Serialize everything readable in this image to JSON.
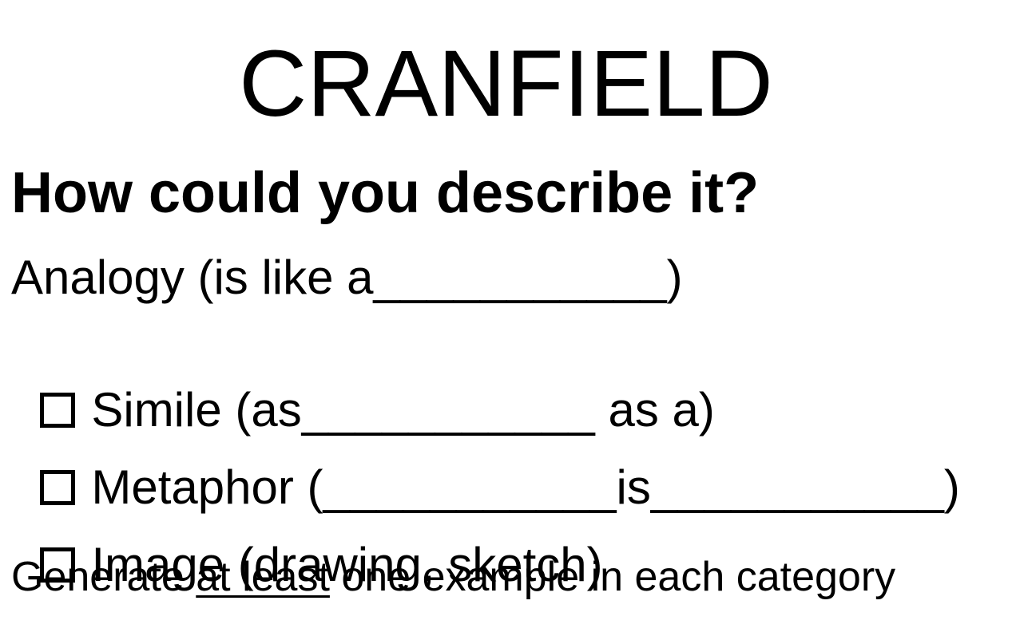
{
  "document": {
    "title": "CRANFIELD",
    "heading": "How could you describe it?",
    "analogy": "Analogy (is like a___________)",
    "simile": "Simile (as___________ as a)",
    "metaphor": "Metaphor (___________is___________)",
    "image": "Image (drawing, sketch)",
    "footer": {
      "before": "Generate ",
      "emphasis": "at least",
      "after": " one example in each category"
    }
  }
}
